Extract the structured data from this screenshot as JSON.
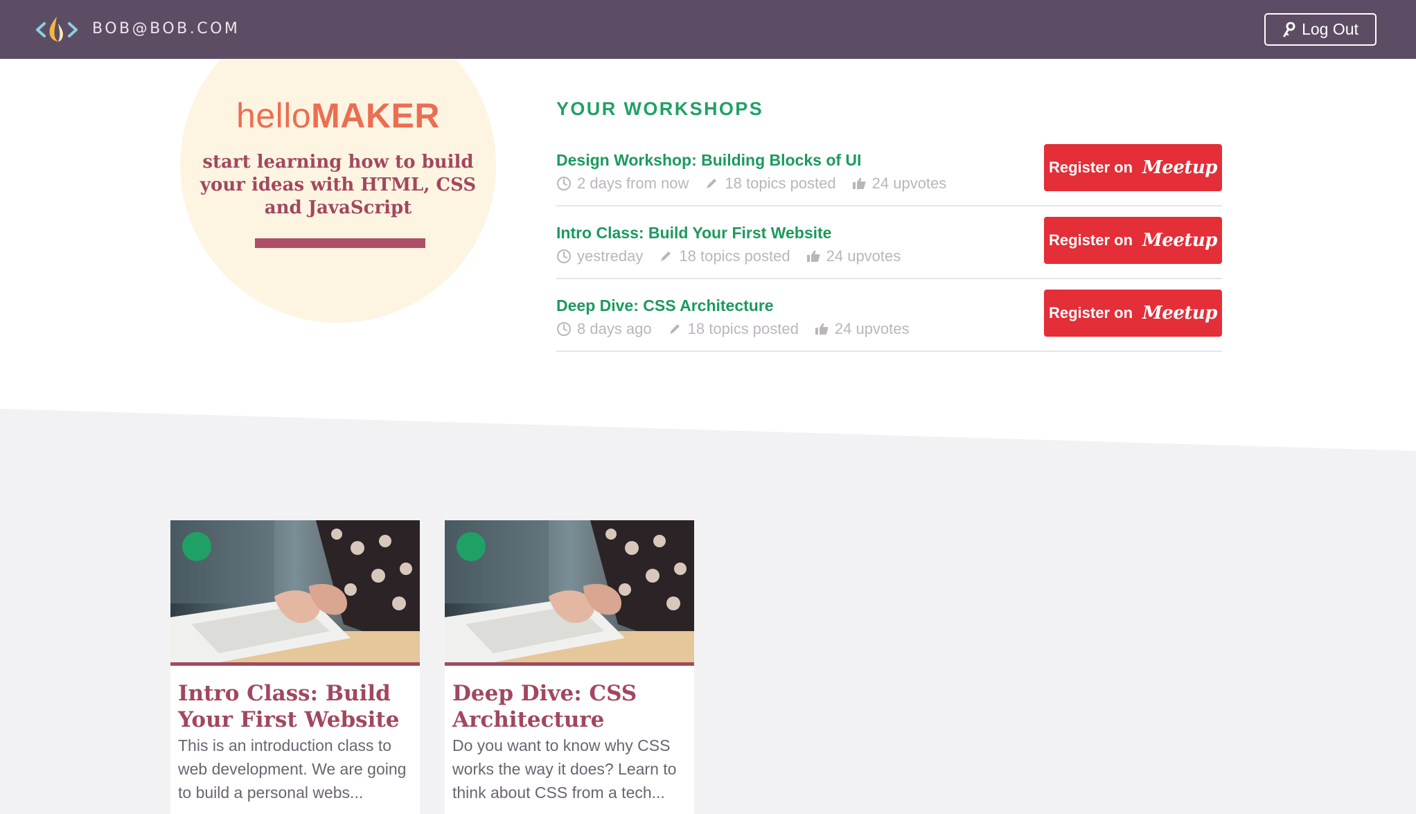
{
  "nav": {
    "user_email": "BOB@BOB.COM",
    "logout_label": "Log Out"
  },
  "hero": {
    "brand_light": "hello",
    "brand_bold": "MAKER",
    "tagline": "start learning how to build your ideas with HTML, CSS and JavaScript"
  },
  "workshops": {
    "heading": "YOUR WORKSHOPS",
    "register_label": "Register on",
    "register_brand": "Meetup",
    "items": [
      {
        "name": "Design Workshop: Building Blocks of UI",
        "time": "2 days from now",
        "topics": "18 topics posted",
        "upvotes": "24 upvotes"
      },
      {
        "name": "Intro Class: Build Your First Website",
        "time": "yestreday",
        "topics": "18 topics posted",
        "upvotes": "24 upvotes"
      },
      {
        "name": "Deep Dive: CSS Architecture",
        "time": "8 days ago",
        "topics": "18 topics posted",
        "upvotes": "24 upvotes"
      }
    ]
  },
  "cards": [
    {
      "title": "Intro Class: Build Your First Website",
      "description": "This is an introduction class to web development. We are going to build a personal webs..."
    },
    {
      "title": "Deep Dive: CSS Architecture",
      "description": "Do you want to know why CSS works the way it does? Learn to think about CSS from a tech..."
    }
  ],
  "colors": {
    "nav_bg": "#5d4d64",
    "accent_green": "#1fa165",
    "register_red": "#e42e38",
    "brand_coral": "#ec6e52",
    "maroon": "#a2475e",
    "section_grey": "#f2f2f4"
  },
  "icons": {
    "logo": "code-flame-logo",
    "logout": "key-icon",
    "time": "clock-icon",
    "topics": "pencil-icon",
    "upvotes": "thumbs-up-icon",
    "status": "green-status-dot"
  }
}
